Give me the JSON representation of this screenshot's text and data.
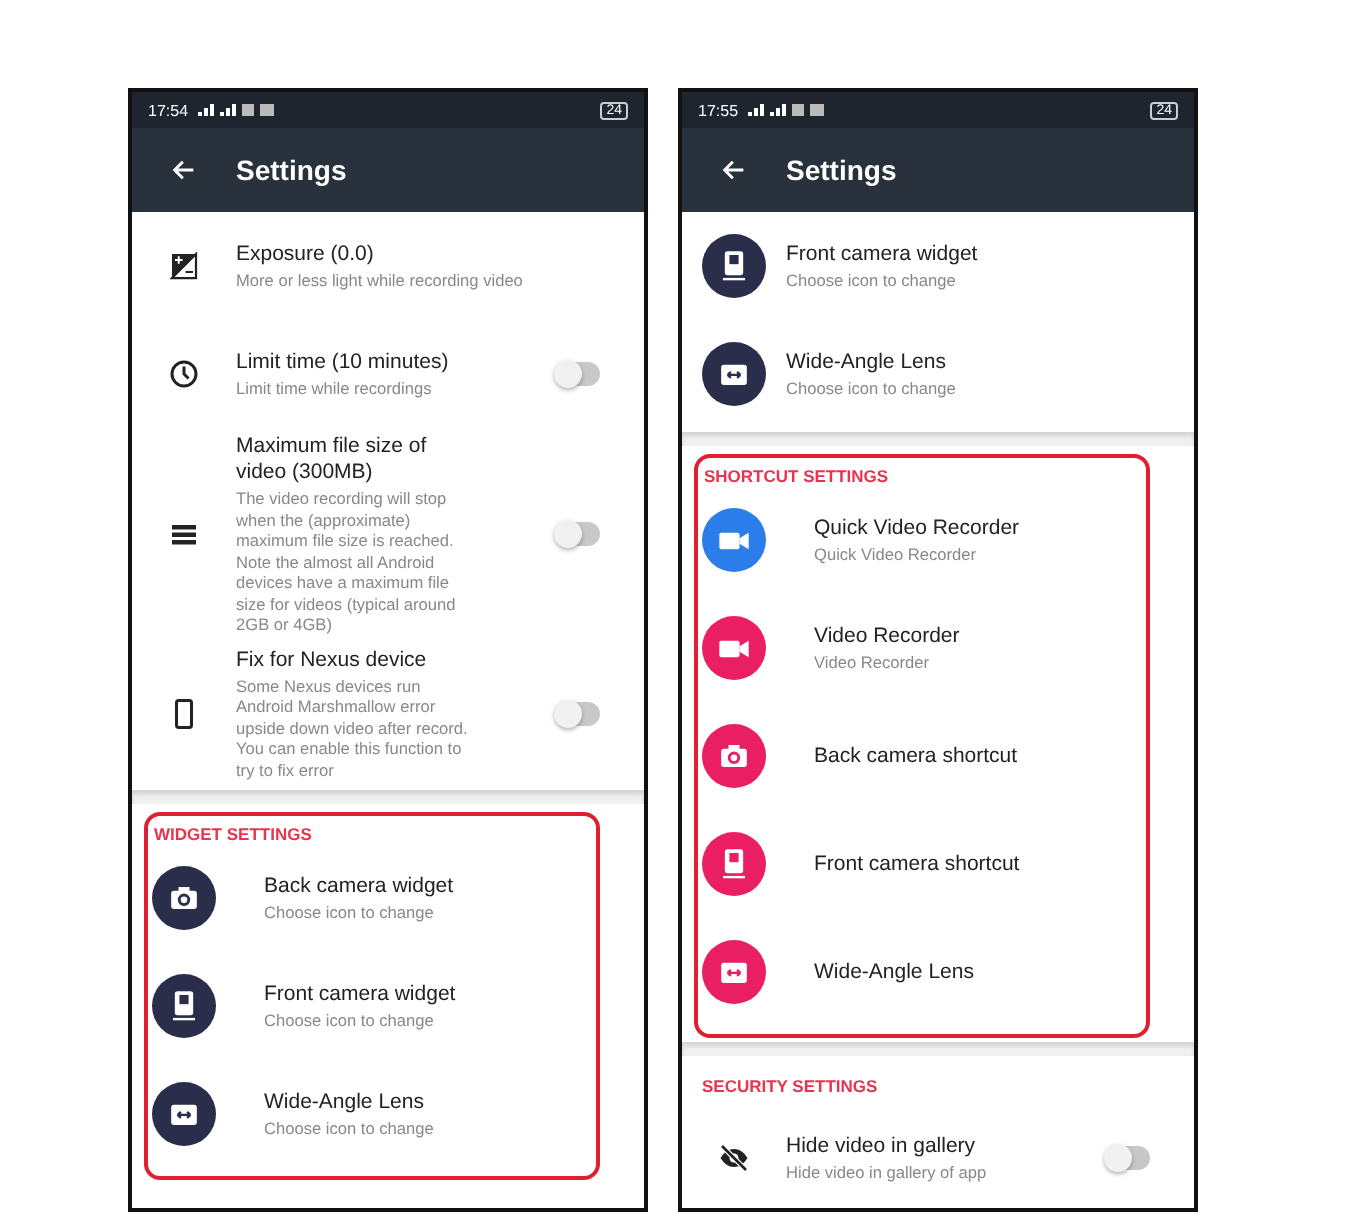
{
  "phones": [
    {
      "status_time": "17:54",
      "battery": "24",
      "title": "Settings",
      "sections": [
        {
          "highlighted": false,
          "items": [
            {
              "kind": "exposure",
              "title": "Exposure (0.0)",
              "subtitle": "More or less light while recording video"
            },
            {
              "kind": "clock",
              "title": "Limit time (10 minutes)",
              "subtitle": "Limit time while recordings",
              "toggle": false
            },
            {
              "kind": "list",
              "title": "Maximum file size of video (300MB)",
              "subtitle": "The video recording will stop when the (approximate) maximum file size is reached. Note the almost all Android devices have a maximum file size for videos (typical around 2GB or 4GB)",
              "toggle": false
            },
            {
              "kind": "phone",
              "title": "Fix for Nexus device",
              "subtitle": "Some Nexus devices run Android Marshmallow error upside down video after record. You can enable this function to try to fix error",
              "toggle": false
            }
          ]
        },
        {
          "header": "WIDGET SETTINGS",
          "highlighted": true,
          "items": [
            {
              "kind": "camera",
              "color": "#2a2e4a",
              "title": "Back camera widget",
              "subtitle": "Choose icon to change"
            },
            {
              "kind": "front-camera",
              "color": "#2a2e4a",
              "title": "Front camera widget",
              "subtitle": "Choose icon to change"
            },
            {
              "kind": "wide-angle",
              "color": "#2a2e4a",
              "title": "Wide-Angle Lens",
              "subtitle": "Choose icon to change"
            }
          ]
        }
      ]
    },
    {
      "status_time": "17:55",
      "battery": "24",
      "title": "Settings",
      "sections": [
        {
          "highlighted": false,
          "items": [
            {
              "kind": "front-camera",
              "color": "#2a2e4a",
              "title": "Front camera widget",
              "subtitle": "Choose icon to change"
            },
            {
              "kind": "wide-angle",
              "color": "#2a2e4a",
              "title": "Wide-Angle Lens",
              "subtitle": "Choose icon to change"
            }
          ]
        },
        {
          "header": "SHORTCUT SETTINGS",
          "highlighted": true,
          "items": [
            {
              "kind": "video",
              "color": "#2b7de9",
              "title": "Quick Video Recorder",
              "subtitle": "Quick Video Recorder"
            },
            {
              "kind": "video",
              "color": "#e91e63",
              "title": "Video Recorder",
              "subtitle": "Video Recorder"
            },
            {
              "kind": "camera",
              "color": "#e91e63",
              "title": "Back camera shortcut"
            },
            {
              "kind": "front-camera",
              "color": "#e91e63",
              "title": "Front camera shortcut"
            },
            {
              "kind": "wide-angle",
              "color": "#e91e63",
              "title": "Wide-Angle Lens"
            }
          ]
        },
        {
          "header": "SECURITY SETTINGS",
          "highlighted": false,
          "items": [
            {
              "kind": "eye-off",
              "title": "Hide video in gallery",
              "subtitle": "Hide video in gallery of app",
              "toggle": false
            }
          ]
        }
      ]
    }
  ]
}
